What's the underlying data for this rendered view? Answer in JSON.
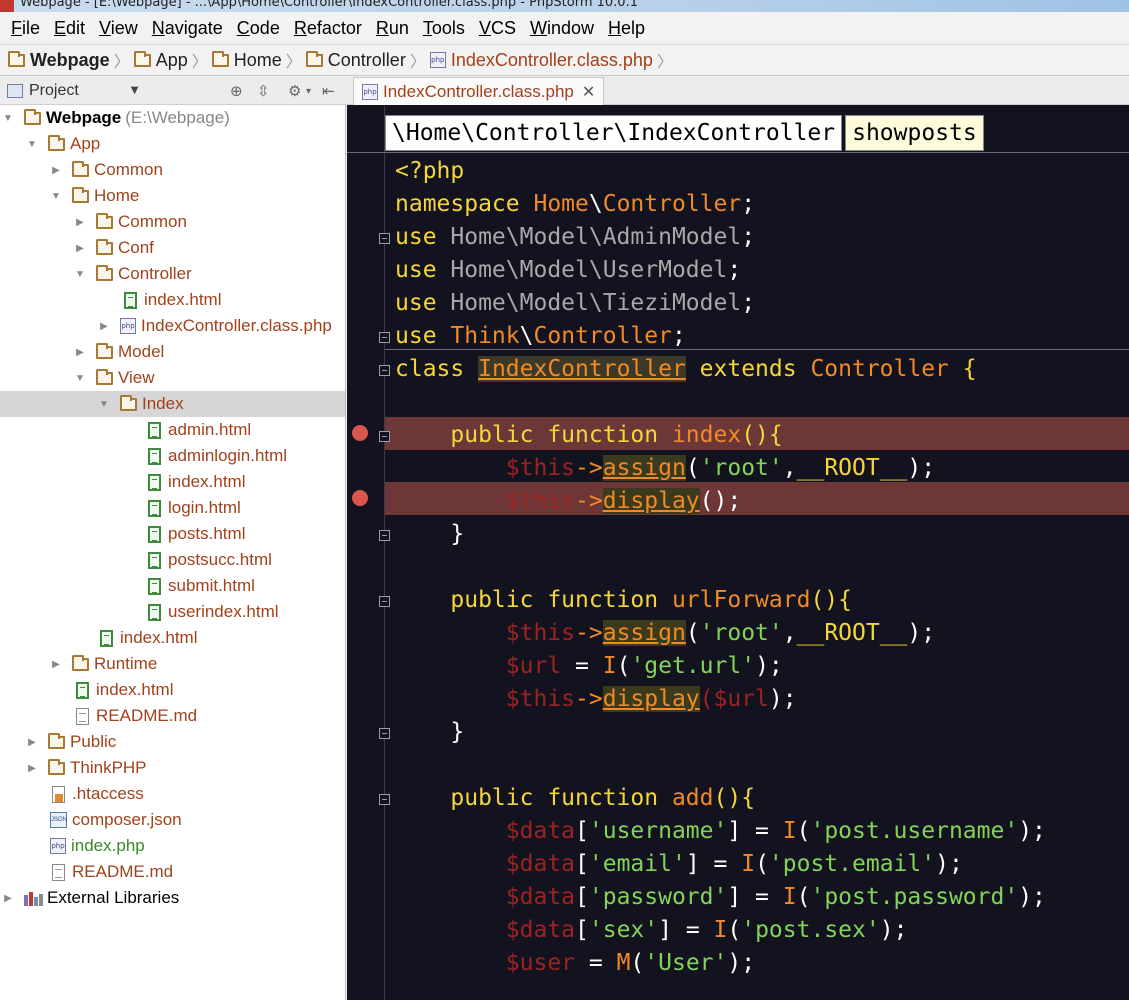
{
  "window": {
    "title": "Webpage - [E:\\Webpage] - ...\\App\\Home\\Controller\\IndexController.class.php - PhpStorm 10.0.1"
  },
  "menu": [
    "File",
    "Edit",
    "View",
    "Navigate",
    "Code",
    "Refactor",
    "Run",
    "Tools",
    "VCS",
    "Window",
    "Help"
  ],
  "breadcrumb": [
    "Webpage",
    "App",
    "Home",
    "Controller",
    "IndexController.class.php"
  ],
  "project_panel": {
    "label": "Project"
  },
  "tree": {
    "root_name": "Webpage",
    "root_path": "(E:\\Webpage)",
    "items": [
      "App",
      "Common",
      "Home",
      "Common",
      "Conf",
      "Controller",
      "index.html",
      "IndexController.class.php",
      "Model",
      "View",
      "Index",
      "admin.html",
      "adminlogin.html",
      "index.html",
      "login.html",
      "posts.html",
      "postsucc.html",
      "submit.html",
      "userindex.html",
      "index.html",
      "Runtime",
      "index.html",
      "README.md",
      "Public",
      "ThinkPHP",
      ".htaccess",
      "composer.json",
      "index.php",
      "README.md",
      "External Libraries"
    ]
  },
  "editor": {
    "tab_label": "IndexController.class.php",
    "method_bar": {
      "namespace": "\\Home\\Controller\\IndexController",
      "method": "showposts"
    },
    "colors": {
      "background": "#13121f",
      "keyword": "#f4d63c",
      "class": "#f08a27",
      "string": "#83d35a",
      "variable": "#9c2323",
      "breakpoint_band": "#6c3736"
    }
  }
}
